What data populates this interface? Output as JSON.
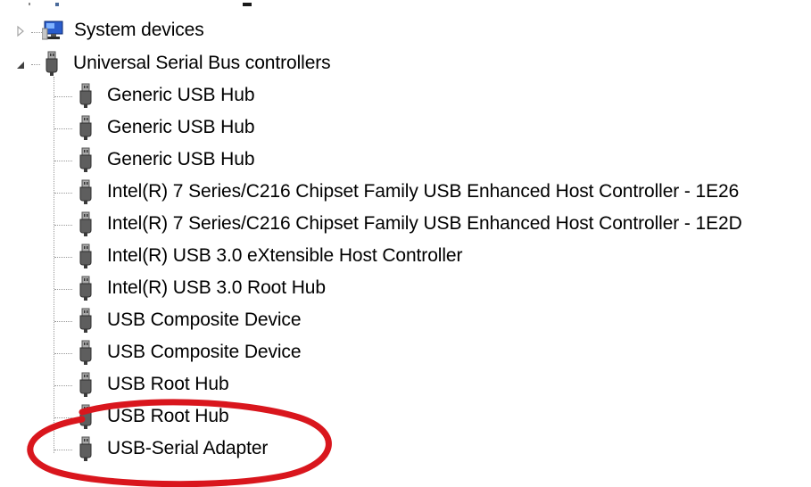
{
  "tree": {
    "system_devices": {
      "label": "System devices",
      "icon": "monitor-icon",
      "expanded": false
    },
    "usb_controllers": {
      "label": "Universal Serial Bus controllers",
      "icon": "usb-plug-icon",
      "expanded": true,
      "children": [
        {
          "label": "Generic USB Hub",
          "icon": "usb-plug-icon"
        },
        {
          "label": "Generic USB Hub",
          "icon": "usb-plug-icon"
        },
        {
          "label": "Generic USB Hub",
          "icon": "usb-plug-icon"
        },
        {
          "label": "Intel(R) 7 Series/C216 Chipset Family USB Enhanced Host Controller - 1E26",
          "icon": "usb-plug-icon"
        },
        {
          "label": "Intel(R) 7 Series/C216 Chipset Family USB Enhanced Host Controller - 1E2D",
          "icon": "usb-plug-icon"
        },
        {
          "label": "Intel(R) USB 3.0 eXtensible Host Controller",
          "icon": "usb-plug-icon"
        },
        {
          "label": "Intel(R) USB 3.0 Root Hub",
          "icon": "usb-plug-icon"
        },
        {
          "label": "USB Composite Device",
          "icon": "usb-plug-icon"
        },
        {
          "label": "USB Composite Device",
          "icon": "usb-plug-icon"
        },
        {
          "label": "USB Root Hub",
          "icon": "usb-plug-icon"
        },
        {
          "label": "USB Root Hub",
          "icon": "usb-plug-icon"
        },
        {
          "label": "USB-Serial Adapter",
          "icon": "usb-plug-icon"
        }
      ]
    }
  },
  "annotation": {
    "highlight_color": "#d9161d",
    "highlighted_item": "USB-Serial Adapter"
  }
}
